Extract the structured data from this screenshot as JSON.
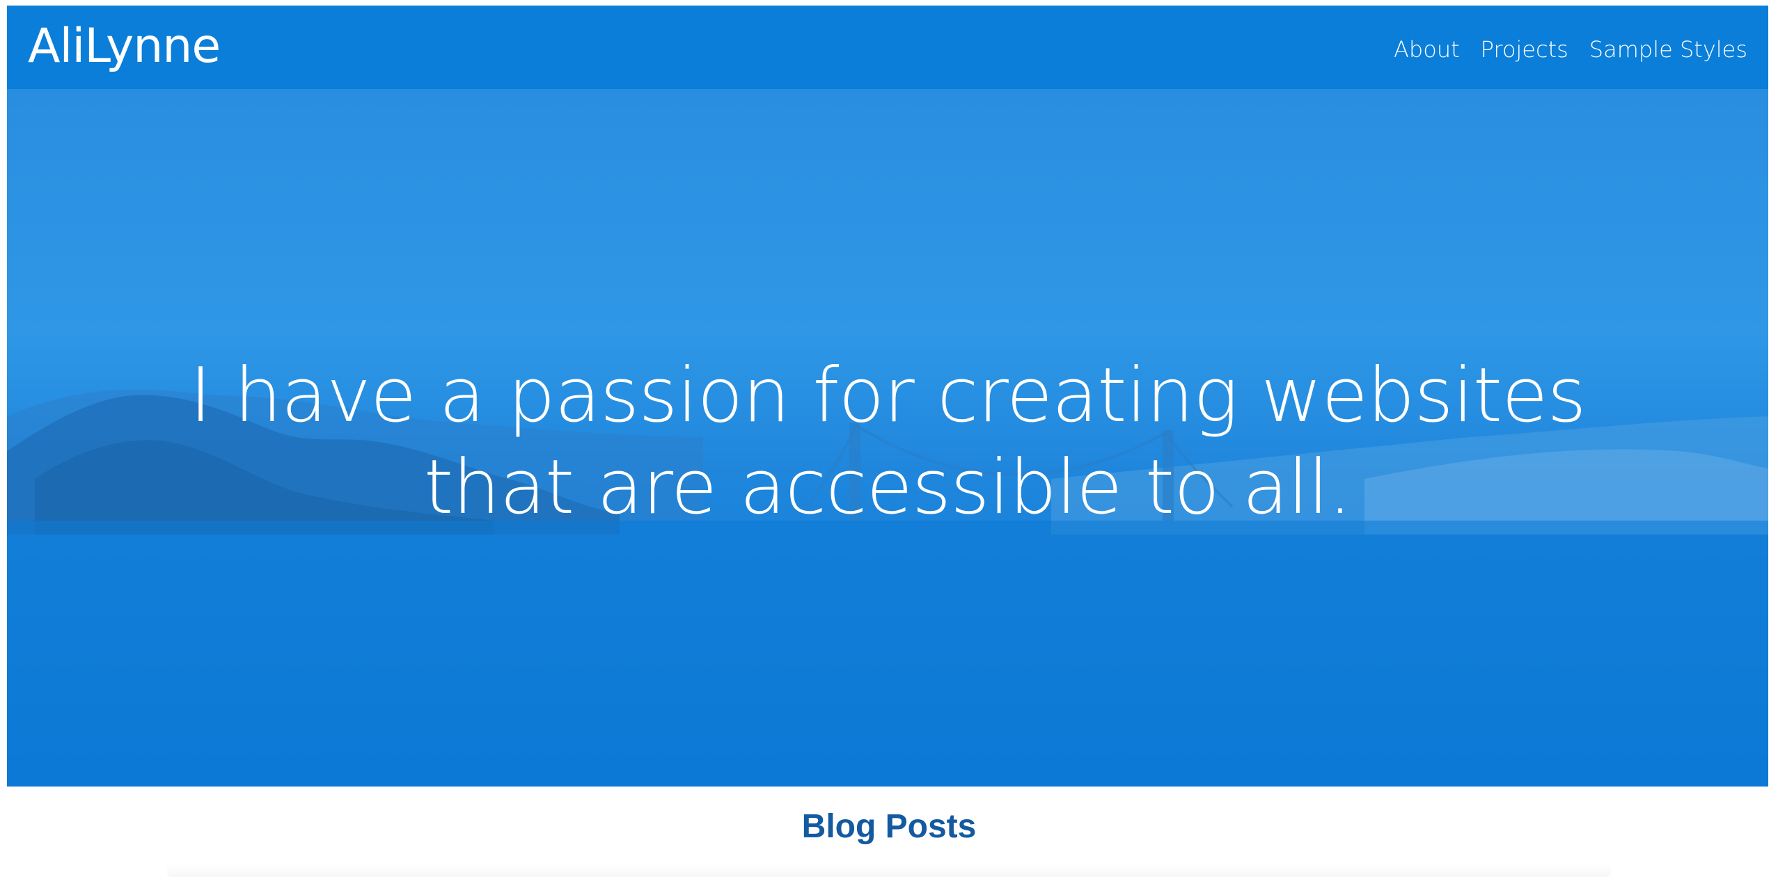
{
  "site": {
    "brand": "AliLynne"
  },
  "nav": {
    "items": [
      {
        "label": "About"
      },
      {
        "label": "Projects"
      },
      {
        "label": "Sample Styles"
      }
    ]
  },
  "hero": {
    "line1": "I have a passion for creating websites",
    "line2": "that are accessible to all."
  },
  "sections": {
    "blog_title": "Blog Posts"
  },
  "colors": {
    "navbar": "#0a7ed8",
    "hero_overlay": "#1f86dc",
    "heading": "#145aa0"
  }
}
